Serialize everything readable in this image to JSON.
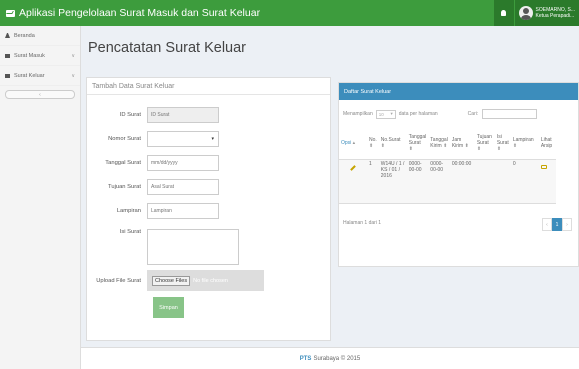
{
  "header": {
    "title": "Aplikasi Pengelolaan Surat Masuk dan Surat Keluar",
    "user_name": "SOEMARNO, S...",
    "user_role": "Ketua Perapadi..."
  },
  "sidebar": {
    "items": [
      {
        "label": "Beranda",
        "icon": "home-icon"
      },
      {
        "label": "Surat Masuk",
        "icon": "envelope-icon"
      },
      {
        "label": "Surat Keluar",
        "icon": "envelope-icon"
      }
    ],
    "collapse_label": "‹"
  },
  "page": {
    "title": "Pencatatan Surat Keluar"
  },
  "form": {
    "title": "Tambah Data Surat Keluar",
    "fields": [
      {
        "label": "ID Surat",
        "placeholder": "ID Surat"
      },
      {
        "label": "Nomor Surat",
        "placeholder": ""
      },
      {
        "label": "Tanggal Surat",
        "placeholder": "mm/dd/yyyy"
      },
      {
        "label": "Tujuan Surat",
        "placeholder": "Asal Surat"
      },
      {
        "label": "Lampiran",
        "placeholder": "Lampiran"
      },
      {
        "label": "Isi Surat",
        "placeholder": ""
      },
      {
        "label": "Upload File Surat",
        "placeholder": ""
      }
    ],
    "file_button": "Choose Files",
    "file_status": "No file chosen",
    "submit_label": "Simpan"
  },
  "list": {
    "title": "Daftar Surat Keluar",
    "show_prefix": "Menampilkan",
    "show_value": "10",
    "show_suffix": "data per halaman",
    "search_label": "Cari:",
    "columns": [
      "Opsi",
      "No.",
      "No.Surat",
      "Tanggal Surat",
      "Tanggal Kirim",
      "Jam Kirim",
      "Tujuan Surat",
      "Isi Surat",
      "Lampiran",
      "Lihat Arsip"
    ],
    "rows": [
      {
        "no": "1",
        "no_surat": "W14U / 1 / KS / 01 / 2016",
        "tanggal_surat": "0000-00-00",
        "tanggal_kirim": "0000-00-00",
        "jam_kirim": "00:00:00",
        "tujuan": "",
        "isi": "",
        "lampiran": "0"
      }
    ],
    "page_info": "Halaman 1 dari 1",
    "pager": [
      "‹",
      "1",
      "›"
    ]
  },
  "footer": {
    "brand": "PTS",
    "text": "Surabaya © 2015"
  },
  "colors": {
    "header": "#3d9c3d",
    "accent": "#3c8dbc"
  }
}
